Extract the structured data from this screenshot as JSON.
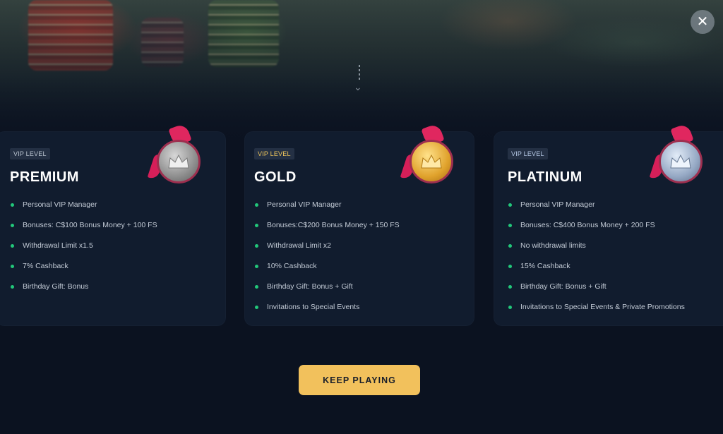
{
  "close": {
    "icon": "close-icon",
    "symbol": "✕"
  },
  "cards": [
    {
      "badge": "VIP LEVEL",
      "title": "PREMIUM",
      "medal": "silver-crown-medal-icon",
      "perks": [
        "Personal VIP Manager",
        "Bonuses: C$100 Bonus Money + 100 FS",
        "Withdrawal Limit x1.5",
        "7% Cashback",
        "Birthday Gift: Bonus"
      ]
    },
    {
      "badge": "VIP LEVEL",
      "title": "GOLD",
      "medal": "gold-crown-medal-icon",
      "perks": [
        "Personal VIP Manager",
        "Bonuses:C$200 Bonus Money + 150 FS",
        "Withdrawal Limit x2",
        "10% Cashback",
        "Birthday Gift: Bonus + Gift",
        "Invitations to Special Events"
      ]
    },
    {
      "badge": "VIP LEVEL",
      "title": "PLATINUM",
      "medal": "platinum-crown-medal-icon",
      "perks": [
        "Personal VIP Manager",
        "Bonuses: C$400 Bonus Money + 200 FS",
        "No withdrawal limits",
        "15% Cashback",
        "Birthday Gift: Bonus + Gift",
        "Invitations to Special Events & Private Promotions"
      ]
    }
  ],
  "cta": {
    "label": "KEEP PLAYING"
  },
  "colors": {
    "accent": "#f2c15c",
    "bullet": "#22c77a",
    "ribbon": "#e0275f",
    "card_bg": "#111c2e"
  }
}
